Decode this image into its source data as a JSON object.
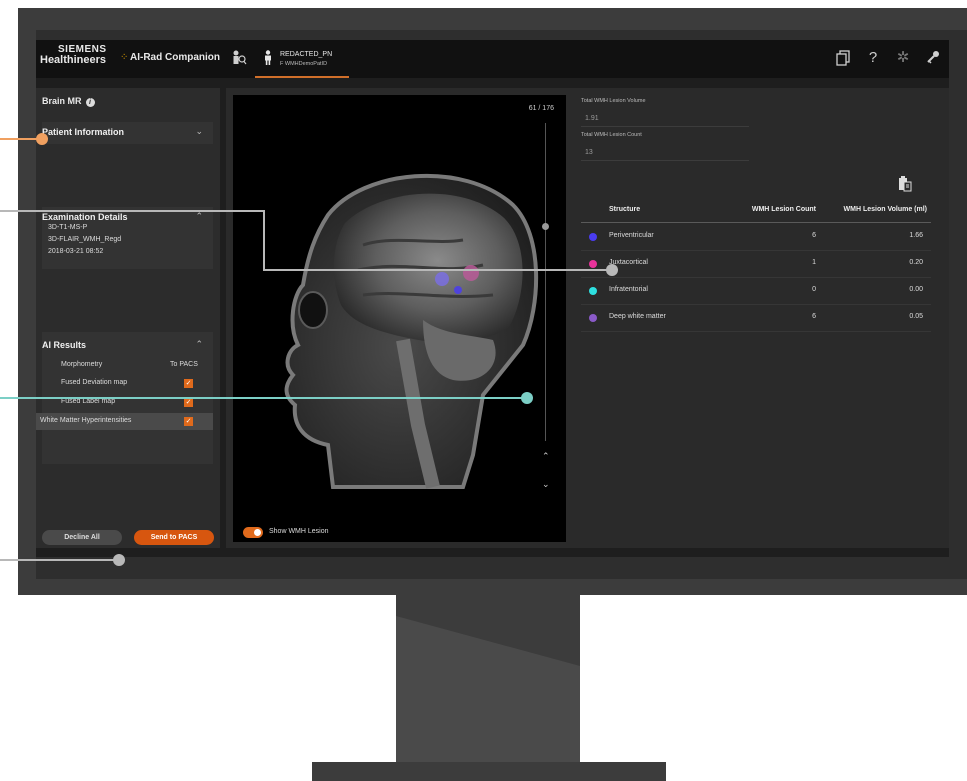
{
  "header": {
    "brand_line1": "SIEMENS",
    "brand_line2": "Healthineers",
    "app_name": "AI-Rad Companion",
    "patient_name": "REDACTED_PN",
    "patient_id": "F WMHDemoPatID",
    "icons": [
      "search-person-icon",
      "person-icon",
      "documents-icon",
      "help-icon",
      "gear-icon",
      "key-icon"
    ]
  },
  "left_panel": {
    "title": "Brain MR",
    "patient_info": {
      "title": "Patient Information"
    },
    "exam": {
      "title": "Examination Details",
      "lines": [
        "3D-T1-MS-P",
        "3D-FLAIR_WMH_Regd",
        "2018-03-21 08:52"
      ]
    },
    "ai_results": {
      "title": "AI Results",
      "morphometry_label": "Morphometry",
      "to_pacs_label": "To PACS",
      "items": [
        {
          "label": "Fused Deviation map",
          "checked": true
        },
        {
          "label": "Fused Label map",
          "checked": true
        },
        {
          "label": "White Matter Hyperintensities",
          "checked": true
        }
      ]
    },
    "decline_label": "Decline All",
    "send_label": "Send to PACS"
  },
  "viewer": {
    "slice": "61 / 176",
    "toggle_label": "Show WMH Lesion",
    "toggle_on": true
  },
  "results": {
    "total_volume_label": "Total WMH Lesion Volume",
    "total_volume_value": "1.91",
    "total_count_label": "Total WMH Lesion Count",
    "total_count_value": "13",
    "table": {
      "columns": [
        "Structure",
        "WMH Lesion Count",
        "WMH Lesion Volume (ml)"
      ],
      "rows": [
        {
          "name": "Periventricular",
          "count": "6",
          "volume": "1.66",
          "color": "#4a3cf0"
        },
        {
          "name": "Juxtacortical",
          "count": "1",
          "volume": "0.20",
          "color": "#e8329a"
        },
        {
          "name": "Infratentorial",
          "count": "0",
          "volume": "0.00",
          "color": "#2ee0e0"
        },
        {
          "name": "Deep white matter",
          "count": "6",
          "volume": "0.05",
          "color": "#8a5ac8"
        }
      ]
    }
  },
  "colors": {
    "accent": "#d7560f",
    "callout_orange": "#f0a060",
    "callout_grey": "#b8b8b8",
    "callout_teal": "#7ccfc6"
  }
}
